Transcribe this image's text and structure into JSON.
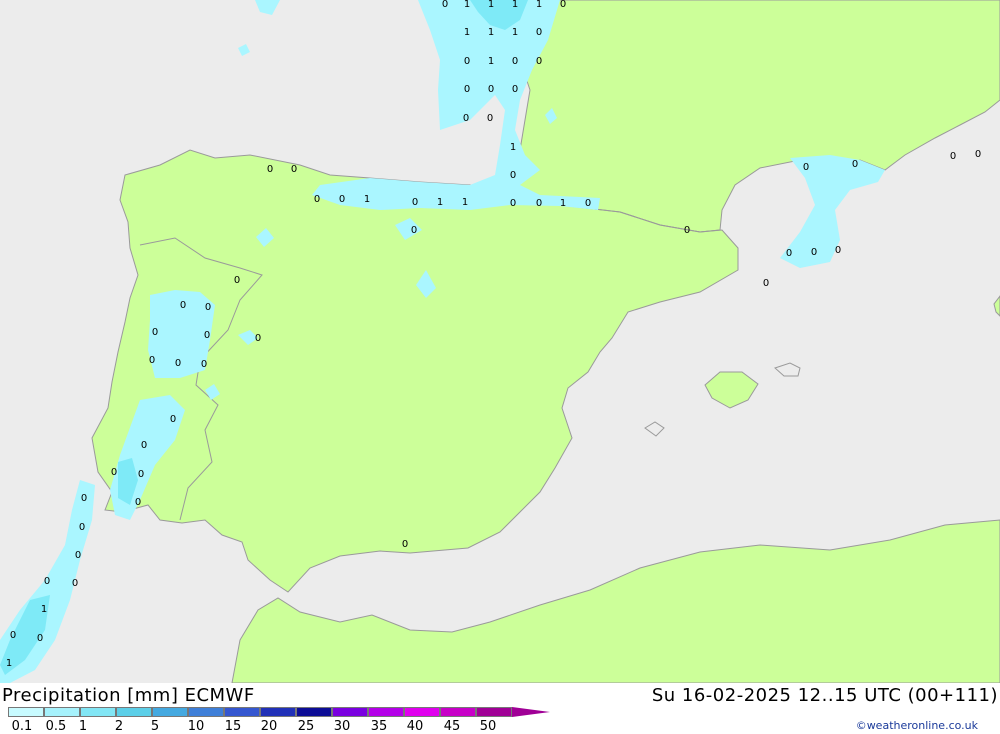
{
  "title_left": "Precipitation [mm] ECMWF",
  "title_right": "Su 16-02-2025 12..15 UTC (00+111)",
  "credit": "©weatheronline.co.uk",
  "colors": {
    "sea": "#ececec",
    "land": "#ccff99",
    "precip_light": "#aaf6ff",
    "precip_medium": "#7eeaf7",
    "precip_strong": "#55d2ea",
    "coast": "#9a9a9a"
  },
  "legend": {
    "ticks": [
      "0.1",
      "0.5",
      "1",
      "2",
      "5",
      "10",
      "15",
      "20",
      "25",
      "30",
      "35",
      "40",
      "45",
      "50"
    ],
    "swatch_colors": [
      "#c8fbff",
      "#a6f2fc",
      "#82e6f5",
      "#5ccfe8",
      "#45a9e0",
      "#3f7fd8",
      "#3557d0",
      "#2131b8",
      "#0d0d96",
      "#7a00e0",
      "#b400e8",
      "#e000ee",
      "#c800c8",
      "#a00096"
    ]
  },
  "map_labels": [
    {
      "t": "0"
    },
    {
      "t": "1"
    },
    {
      "t": "1"
    },
    {
      "t": "1"
    },
    {
      "t": "1"
    },
    {
      "t": "0"
    },
    {
      "t": "1"
    },
    {
      "t": "1"
    },
    {
      "t": "1"
    },
    {
      "t": "0"
    },
    {
      "t": "0"
    },
    {
      "t": "1"
    },
    {
      "t": "0"
    },
    {
      "t": "0"
    },
    {
      "t": "0"
    },
    {
      "t": "0"
    },
    {
      "t": "0"
    },
    {
      "t": "0"
    },
    {
      "t": "0"
    },
    {
      "t": "1"
    },
    {
      "t": "0"
    },
    {
      "t": "0"
    },
    {
      "t": "0"
    },
    {
      "t": "0"
    },
    {
      "t": "0"
    },
    {
      "t": "1"
    },
    {
      "t": "0"
    },
    {
      "t": "1"
    },
    {
      "t": "1"
    },
    {
      "t": "0"
    },
    {
      "t": "0"
    },
    {
      "t": "1"
    },
    {
      "t": "0"
    },
    {
      "t": "0"
    },
    {
      "t": "0"
    },
    {
      "t": "0"
    },
    {
      "t": "0"
    },
    {
      "t": "0"
    },
    {
      "t": "0"
    },
    {
      "t": "0"
    },
    {
      "t": "0"
    },
    {
      "t": "0"
    },
    {
      "t": "0"
    },
    {
      "t": "0"
    },
    {
      "t": "0"
    },
    {
      "t": "0"
    },
    {
      "t": "0"
    },
    {
      "t": "0"
    },
    {
      "t": "0"
    },
    {
      "t": "0"
    },
    {
      "t": "0"
    },
    {
      "t": "0"
    },
    {
      "t": "0"
    },
    {
      "t": "0"
    },
    {
      "t": "1"
    },
    {
      "t": "0"
    },
    {
      "t": "0"
    },
    {
      "t": "1"
    },
    {
      "t": "0"
    },
    {
      "t": "0"
    },
    {
      "t": "0"
    },
    {
      "t": "0"
    },
    {
      "t": "0"
    },
    {
      "t": "0"
    },
    {
      "t": "0"
    },
    {
      "t": "0"
    },
    {
      "t": "0"
    }
  ]
}
